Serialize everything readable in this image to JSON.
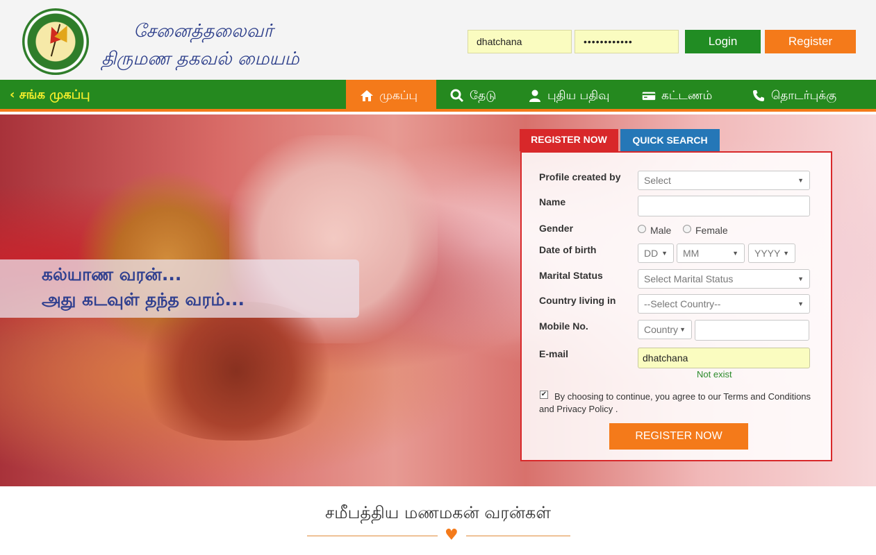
{
  "header": {
    "brand_line1": "சேனைத்தலைவர்",
    "brand_line2": "திருமண தகவல் மையம்",
    "username_value": "dhatchana",
    "password_masked": "••••••••••••",
    "login_label": "Login",
    "register_label": "Register"
  },
  "nav": {
    "back_label": "சங்க முகப்பு",
    "items": [
      {
        "label": "முகப்பு",
        "icon": "home-icon"
      },
      {
        "label": "தேடு",
        "icon": "search-icon"
      },
      {
        "label": "புதிய பதிவு",
        "icon": "user-icon"
      },
      {
        "label": "கட்டணம்",
        "icon": "credit-card-icon"
      },
      {
        "label": "தொடர்புக்கு",
        "icon": "phone-icon"
      }
    ]
  },
  "hero": {
    "tagline1": "கல்யாண வரன்...",
    "tagline2": "அது கடவுள் தந்த வரம்..."
  },
  "form": {
    "tab_register": "REGISTER NOW",
    "tab_quick": "QUICK SEARCH",
    "profile_label": "Profile created by",
    "profile_value": "Select",
    "name_label": "Name",
    "name_value": "",
    "gender_label": "Gender",
    "male_label": "Male",
    "female_label": "Female",
    "dob_label": "Date of birth",
    "dd": "DD",
    "mm": "MM",
    "yyyy": "YYYY",
    "marital_label": "Marital Status",
    "marital_value": "Select Marital Status",
    "country_label": "Country living in",
    "country_value": "--Select Country--",
    "mobile_label": "Mobile No.",
    "mobile_country": "Country",
    "mobile_value": "",
    "email_label": "E-mail",
    "email_value": "dhatchana",
    "email_status": "Not exist",
    "terms_text": "By choosing to continue, you agree to our Terms and Conditions and Privacy Policy .",
    "submit_label": "REGISTER NOW"
  },
  "recent": {
    "title": "சமீபத்திய மணமகன் வரன்கள்"
  },
  "colors": {
    "green": "#25891f",
    "orange": "#f47a1a",
    "red": "#d8282a",
    "blue": "#2577b7",
    "brand_blue": "#2c3e8a"
  }
}
